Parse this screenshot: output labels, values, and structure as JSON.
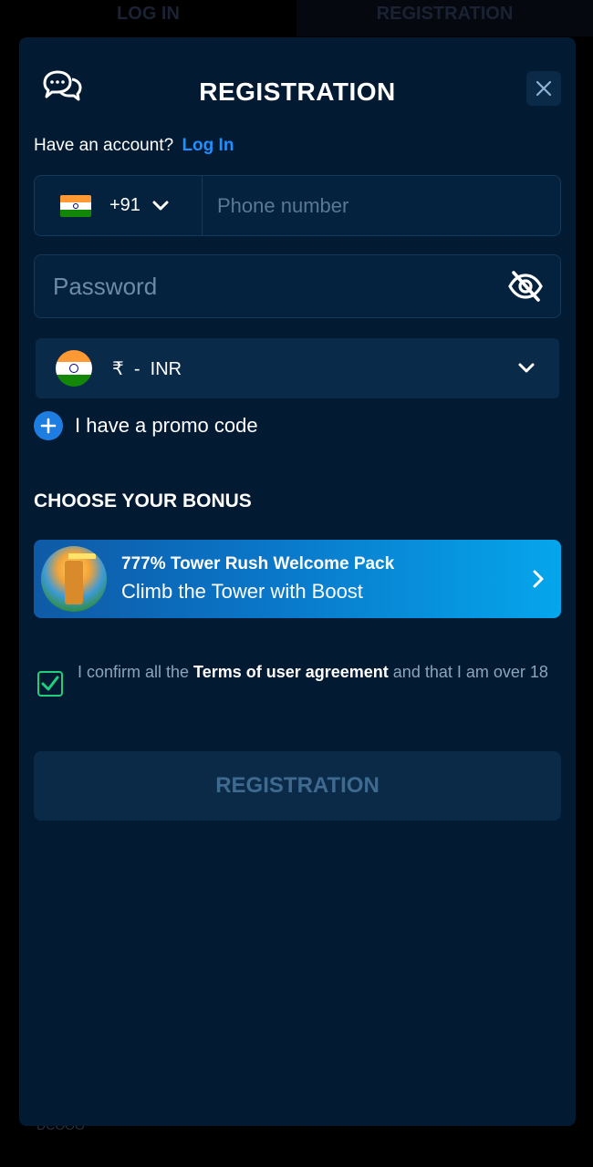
{
  "background": {
    "tabs": [
      "LOG IN",
      "REGISTRATION"
    ],
    "footer_text": "DCOOO"
  },
  "modal": {
    "title": "REGISTRATION",
    "have_account_text": "Have an account?",
    "login_link": "Log In",
    "phone": {
      "country_code": "+91",
      "placeholder": "Phone number",
      "flag": "india-flag"
    },
    "password": {
      "placeholder": "Password",
      "visibility_icon": "eye-slash-icon"
    },
    "currency": {
      "symbol": "₹",
      "separator": "-",
      "code": "INR",
      "flag": "india-flag"
    },
    "promo_text": "I have a promo code",
    "choose_bonus_heading": "CHOOSE YOUR BONUS",
    "bonus": {
      "title": "777% Tower Rush Welcome Pack",
      "subtitle": "Climb the Tower with Boost"
    },
    "terms": {
      "checked": true,
      "prefix": "I confirm all the ",
      "link": "Terms of user agreement",
      "suffix": " and that I am over 18"
    },
    "submit_label": "REGISTRATION"
  },
  "colors": {
    "modal_bg": "#031a33",
    "accent_link": "#1e90ff",
    "checkbox": "#1fcf7d",
    "bonus_gradient_start": "#0f5aa6",
    "bonus_gradient_end": "#05a6ec"
  }
}
